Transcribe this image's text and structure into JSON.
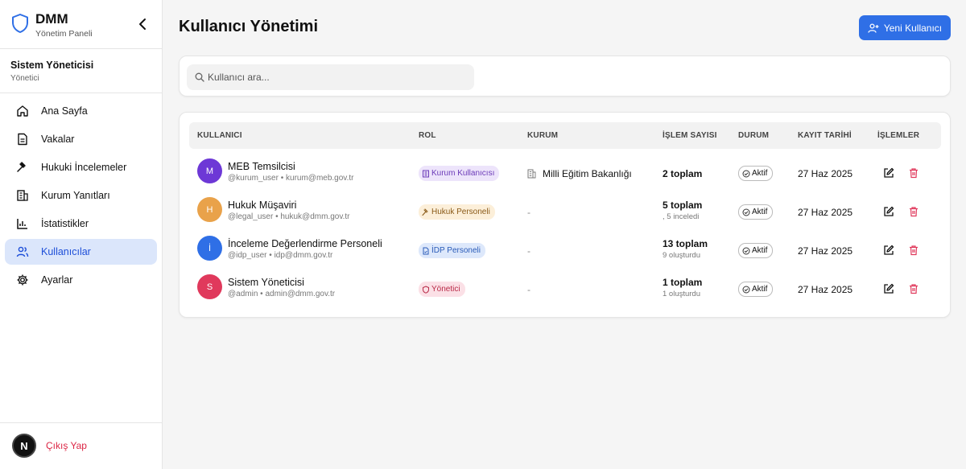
{
  "brand": {
    "title": "DMM",
    "subtitle": "Yönetim Paneli"
  },
  "user": {
    "name": "Sistem Yöneticisi",
    "role": "Yönetici"
  },
  "nav": [
    {
      "label": "Ana Sayfa",
      "icon": "home-icon"
    },
    {
      "label": "Vakalar",
      "icon": "document-icon"
    },
    {
      "label": "Hukuki İncelemeler",
      "icon": "gavel-icon"
    },
    {
      "label": "Kurum Yanıtları",
      "icon": "building-icon"
    },
    {
      "label": "İstatistikler",
      "icon": "bar-chart-icon"
    },
    {
      "label": "Kullanıcılar",
      "icon": "users-icon",
      "active": true
    },
    {
      "label": "Ayarlar",
      "icon": "gear-icon"
    }
  ],
  "footer": {
    "logo": "N",
    "logout": "Çıkış Yap"
  },
  "page": {
    "title": "Kullanıcı Yönetimi",
    "new_user_button": "Yeni Kullanıcı"
  },
  "search": {
    "placeholder": "Kullanıcı ara..."
  },
  "table": {
    "headers": {
      "user": "KULLANICI",
      "role": "ROL",
      "org": "KURUM",
      "ops": "İŞLEM SAYISI",
      "status": "DURUM",
      "date": "KAYIT TARİHİ",
      "actions": "İŞLEMLER"
    },
    "rows": [
      {
        "initial": "M",
        "avatar_color": "#6d38d6",
        "name": "MEB Temsilcisi",
        "username": "@kurum_user",
        "email": "kurum@meb.gov.tr",
        "role": "Kurum Kullanıcısı",
        "role_bg": "#ede4fb",
        "role_color": "#6b3ab8",
        "org": "Milli Eğitim Bakanlığı",
        "ops_total": "2 toplam",
        "ops_sub": "",
        "status": "Aktif",
        "date": "27 Haz 2025"
      },
      {
        "initial": "H",
        "avatar_color": "#e9a24a",
        "name": "Hukuk Müşaviri",
        "username": "@legal_user",
        "email": "hukuk@dmm.gov.tr",
        "role": "Hukuk Personeli",
        "role_bg": "#fcefd9",
        "role_color": "#8a5a18",
        "org": "-",
        "ops_total": "5 toplam",
        "ops_sub": ", 5 inceledi",
        "status": "Aktif",
        "date": "27 Haz 2025"
      },
      {
        "initial": "İ",
        "avatar_color": "#2f6fe6",
        "name": "İnceleme Değerlendirme Personeli",
        "username": "@idp_user",
        "email": "idp@dmm.gov.tr",
        "role": "İDP Personeli",
        "role_bg": "#dde8fb",
        "role_color": "#2a5bb8",
        "org": "-",
        "ops_total": "13 toplam",
        "ops_sub": "9 oluşturdu",
        "status": "Aktif",
        "date": "27 Haz 2025"
      },
      {
        "initial": "S",
        "avatar_color": "#e0395c",
        "name": "Sistem Yöneticisi",
        "username": "@admin",
        "email": "admin@dmm.gov.tr",
        "role": "Yönetici",
        "role_bg": "#fbe0e6",
        "role_color": "#b82a48",
        "org": "-",
        "ops_total": "1 toplam",
        "ops_sub": "1 oluşturdu",
        "status": "Aktif",
        "date": "27 Haz 2025"
      }
    ]
  }
}
